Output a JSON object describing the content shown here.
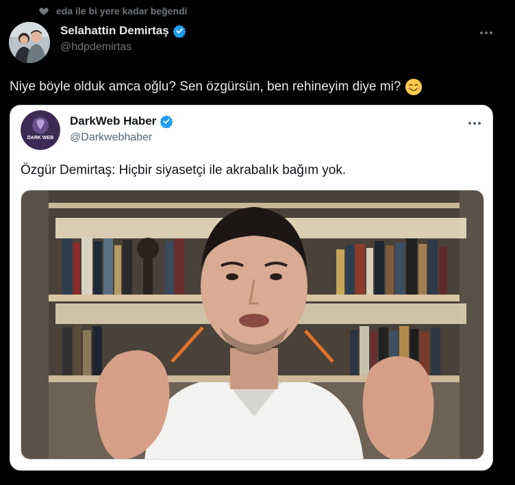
{
  "social_context": {
    "text": "eda ile bi yere kadar beğendi",
    "icon": "heart-icon"
  },
  "tweet": {
    "author_name": "Selahattin Demirtaş",
    "author_handle": "@hdpdemirtas",
    "text": "Niye böyle olduk amca oğlu? Sen özgürsün, ben rehineyim diye mi?",
    "emoji": "smiling-face-emoji"
  },
  "quote": {
    "author_name": "DarkWeb Haber",
    "author_handle": "@Darkwebhaber",
    "avatar_text": "DARK WEB",
    "text": "Özgür Demirtaş: Hiçbir siyasetçi ile akrabalık bağım yok."
  },
  "colors": {
    "background": "#000000",
    "verified": "#1d9bf0",
    "muted": "#71767b",
    "card": "#ffffff"
  }
}
